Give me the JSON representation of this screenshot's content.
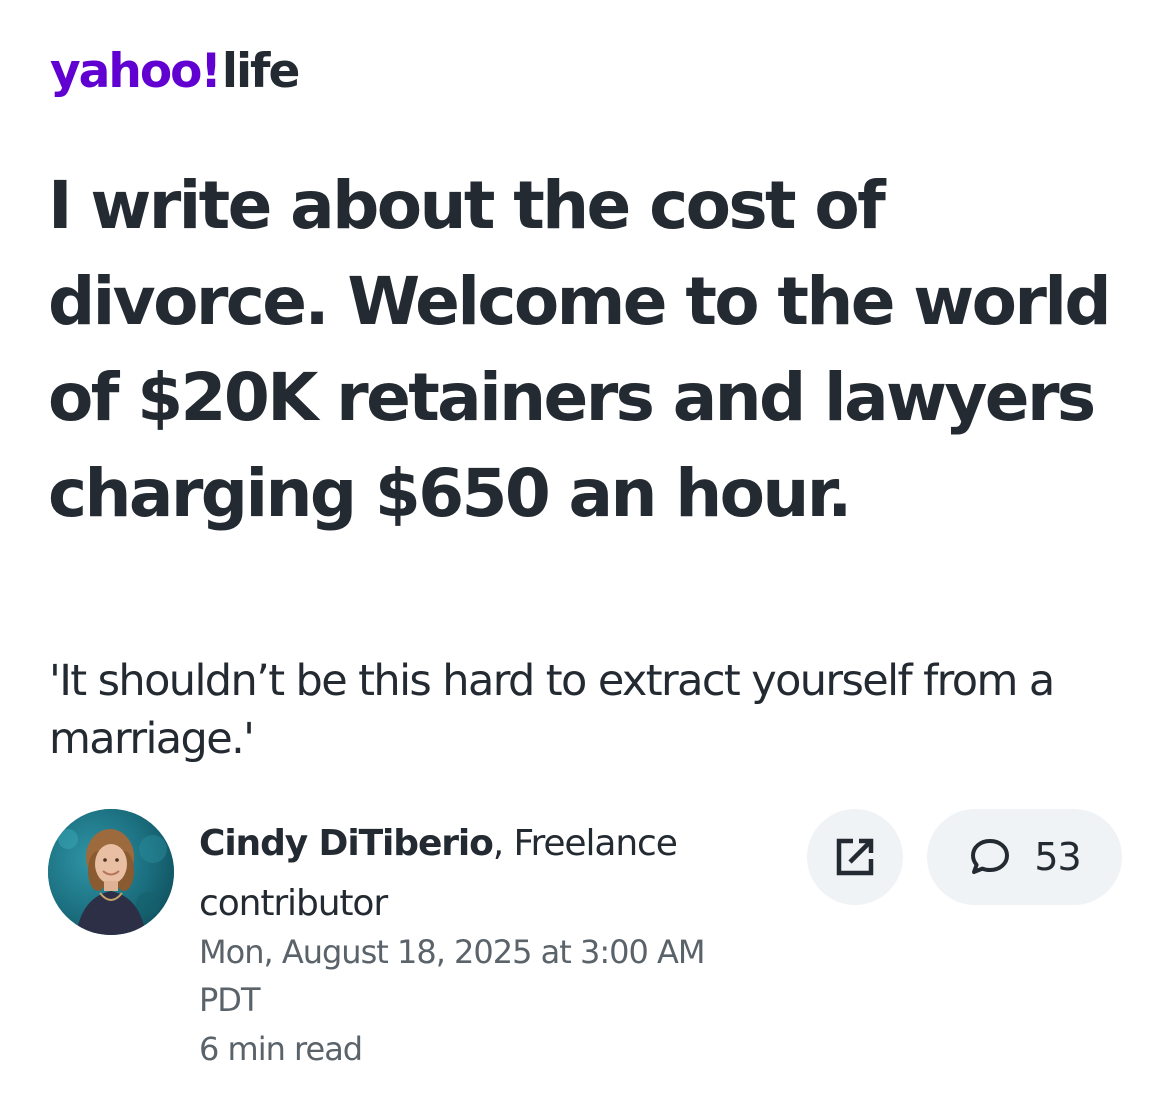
{
  "brand": {
    "yahoo": "yahoo!",
    "section": "life",
    "accent_color": "#6001d2"
  },
  "article": {
    "headline": "I write about the cost of divorce. Welcome to the world of $20K retainers and lawyers charging $650 an hour.",
    "subheadline": "'It shouldn’t be this hard to extract yourself from a marriage.'"
  },
  "byline": {
    "author": "Cindy DiTiberio",
    "separator": ",",
    "role": " Freelance contributor",
    "date": "Mon, August 18, 2025 at 3:00 AM PDT",
    "read_time": "6 min read"
  },
  "actions": {
    "share_icon": "share-external-icon",
    "comment_icon": "speech-bubble-icon",
    "comment_count": "53"
  }
}
